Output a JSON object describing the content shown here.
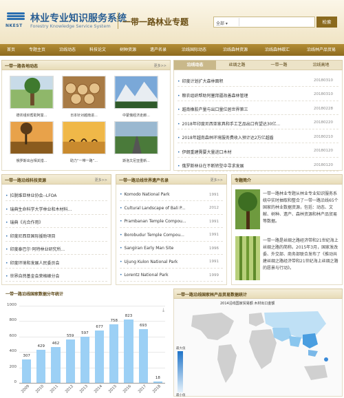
{
  "header": {
    "logo_text": "NKEST",
    "title_cn": "林业专业知识服务系统",
    "title_en": "Forestry Knowledge Service System",
    "subtitle": "一带一路林业专题",
    "search_scope": "全部",
    "search_placeholder": "",
    "search_button": "检索"
  },
  "nav": [
    "首页",
    "专题主页",
    "沿线动态",
    "科技论文",
    "树种资源",
    "遗产名录",
    "沿线国际动态",
    "沿线森林资源",
    "沿线森林碳汇",
    "沿线林产品贸易"
  ],
  "news": {
    "title": "一带一路各地动态",
    "more": "更多>>",
    "items": [
      {
        "caption": "德农组织帮助阿富..."
      },
      {
        "caption": "日本针对越南进..."
      },
      {
        "caption": "中蒙俄经济走廊..."
      },
      {
        "caption": "俄罗斯出台相关措..."
      },
      {
        "caption": "助力“一带一路”..."
      },
      {
        "caption": "斯洛文尼亚重新..."
      }
    ]
  },
  "tabs": {
    "labels": [
      "沿线动态",
      "丝绸之路",
      "一带一路",
      "沿线高地"
    ],
    "items": [
      {
        "text": "印度计划扩大森林面积",
        "date": "20180310"
      },
      {
        "text": "粮农组织帮助阿塞拜疆改善森林管理",
        "date": "20180310"
      },
      {
        "text": "越南橡胶产量与出口量位居世界第三",
        "date": "20180228"
      },
      {
        "text": "2018年印度尼西亚家具和手工艺品出口有望达30亿...",
        "date": "20180220"
      },
      {
        "text": "2018年越南森林环境服务费收入预计达2万亿越盾",
        "date": "20180210"
      },
      {
        "text": "伊朗重建需要大量进口木材",
        "date": "20180120"
      },
      {
        "text": "俄罗斯林业在不断转型中寻求发展",
        "date": "20180120"
      }
    ]
  },
  "tech": {
    "title": "一带一路沿线科技资源",
    "more": "更多>>",
    "items": [
      "拉脱维亚林业协会--LFOA",
      "瑞典生命科学大学林业和木材科...",
      "瑞典《光合作用》",
      "印度尼西亚国际援助项目",
      "印度泰巴尔·阿特林业研究所...",
      "印度环境和发展人民委员会",
      "世界自然基金会荣格峰分会"
    ]
  },
  "heritage": {
    "title": "一带一路沿线世界遗产名录",
    "more": "更多>>",
    "items": [
      {
        "name": "Komodo National Park",
        "year": "1991"
      },
      {
        "name": "Cultural Landscape of Bali P...",
        "year": "2012"
      },
      {
        "name": "Prambanan Temple Compou...",
        "year": "1991"
      },
      {
        "name": "Borobudur Temple Compou...",
        "year": "1991"
      },
      {
        "name": "Sangiran Early Man Site",
        "year": "1996"
      },
      {
        "name": "Ujung Kulon National Park",
        "year": "1991"
      },
      {
        "name": "Lorentz National Park",
        "year": "1999"
      }
    ]
  },
  "intro": {
    "title": "专题简介",
    "p1": "一带一路林业专题从林业专业知识服务系统中实时抽取和整合了一带一路沿线65个国家的林业数据资源，包括：动态、文献、树种、遗产、森林资源和林产品贸易等数据。",
    "p2": "一带一路是丝绸之路经济带和21世纪海上丝绸之路的简称。2015年3月，国家发改委、外交部、商务部联合发布了《推动共建丝绸之路经济带和21世纪海上丝绸之路的愿景与行动》。"
  },
  "chart": {
    "title": "一带一路沿线国家数据分年统计"
  },
  "chart_data": {
    "type": "bar",
    "categories": [
      "2009",
      "2010",
      "2011",
      "2012",
      "2013",
      "2014",
      "2015",
      "2016",
      "2017",
      "2018"
    ],
    "values": [
      307,
      429,
      462,
      559,
      597,
      677,
      758,
      823,
      693,
      18
    ],
    "ylim": [
      0,
      1000
    ],
    "yticks": [
      0,
      200,
      400,
      600,
      800,
      1000
    ]
  },
  "map": {
    "title": "一带一路沿线国家林产品贸易数据统计",
    "inner_title": "2014沿线国家贸易额 木材出口金额",
    "legend_high": "最大值",
    "legend_low": "最小值"
  },
  "colors": {
    "brand": "#2a5f94",
    "nav": "#8d6a1f",
    "bar": "#9cd0f5"
  }
}
